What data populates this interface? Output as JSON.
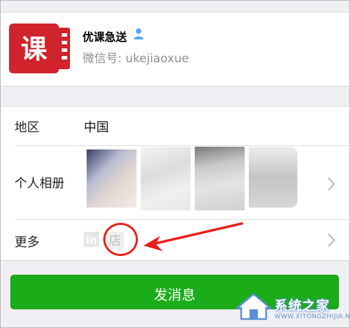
{
  "profile": {
    "name": "优课急送",
    "id_text": "微信号: ukejiaoxue",
    "logo_char": "课",
    "logo_color": "#d0232b",
    "verify_icon": "person-verified-icon"
  },
  "rows": {
    "region_label": "地区",
    "region_value": "中国",
    "album_label": "个人相册",
    "more_label": "更多"
  },
  "more": {
    "icon_a": "in",
    "icon_b": "店"
  },
  "button": {
    "send_label": "发消息",
    "color": "#1aad19"
  },
  "watermark": {
    "text": "系统之家",
    "url": "WWW.XITONGZHIJIA.NET"
  },
  "annotation": {
    "color": "#e8201c"
  }
}
